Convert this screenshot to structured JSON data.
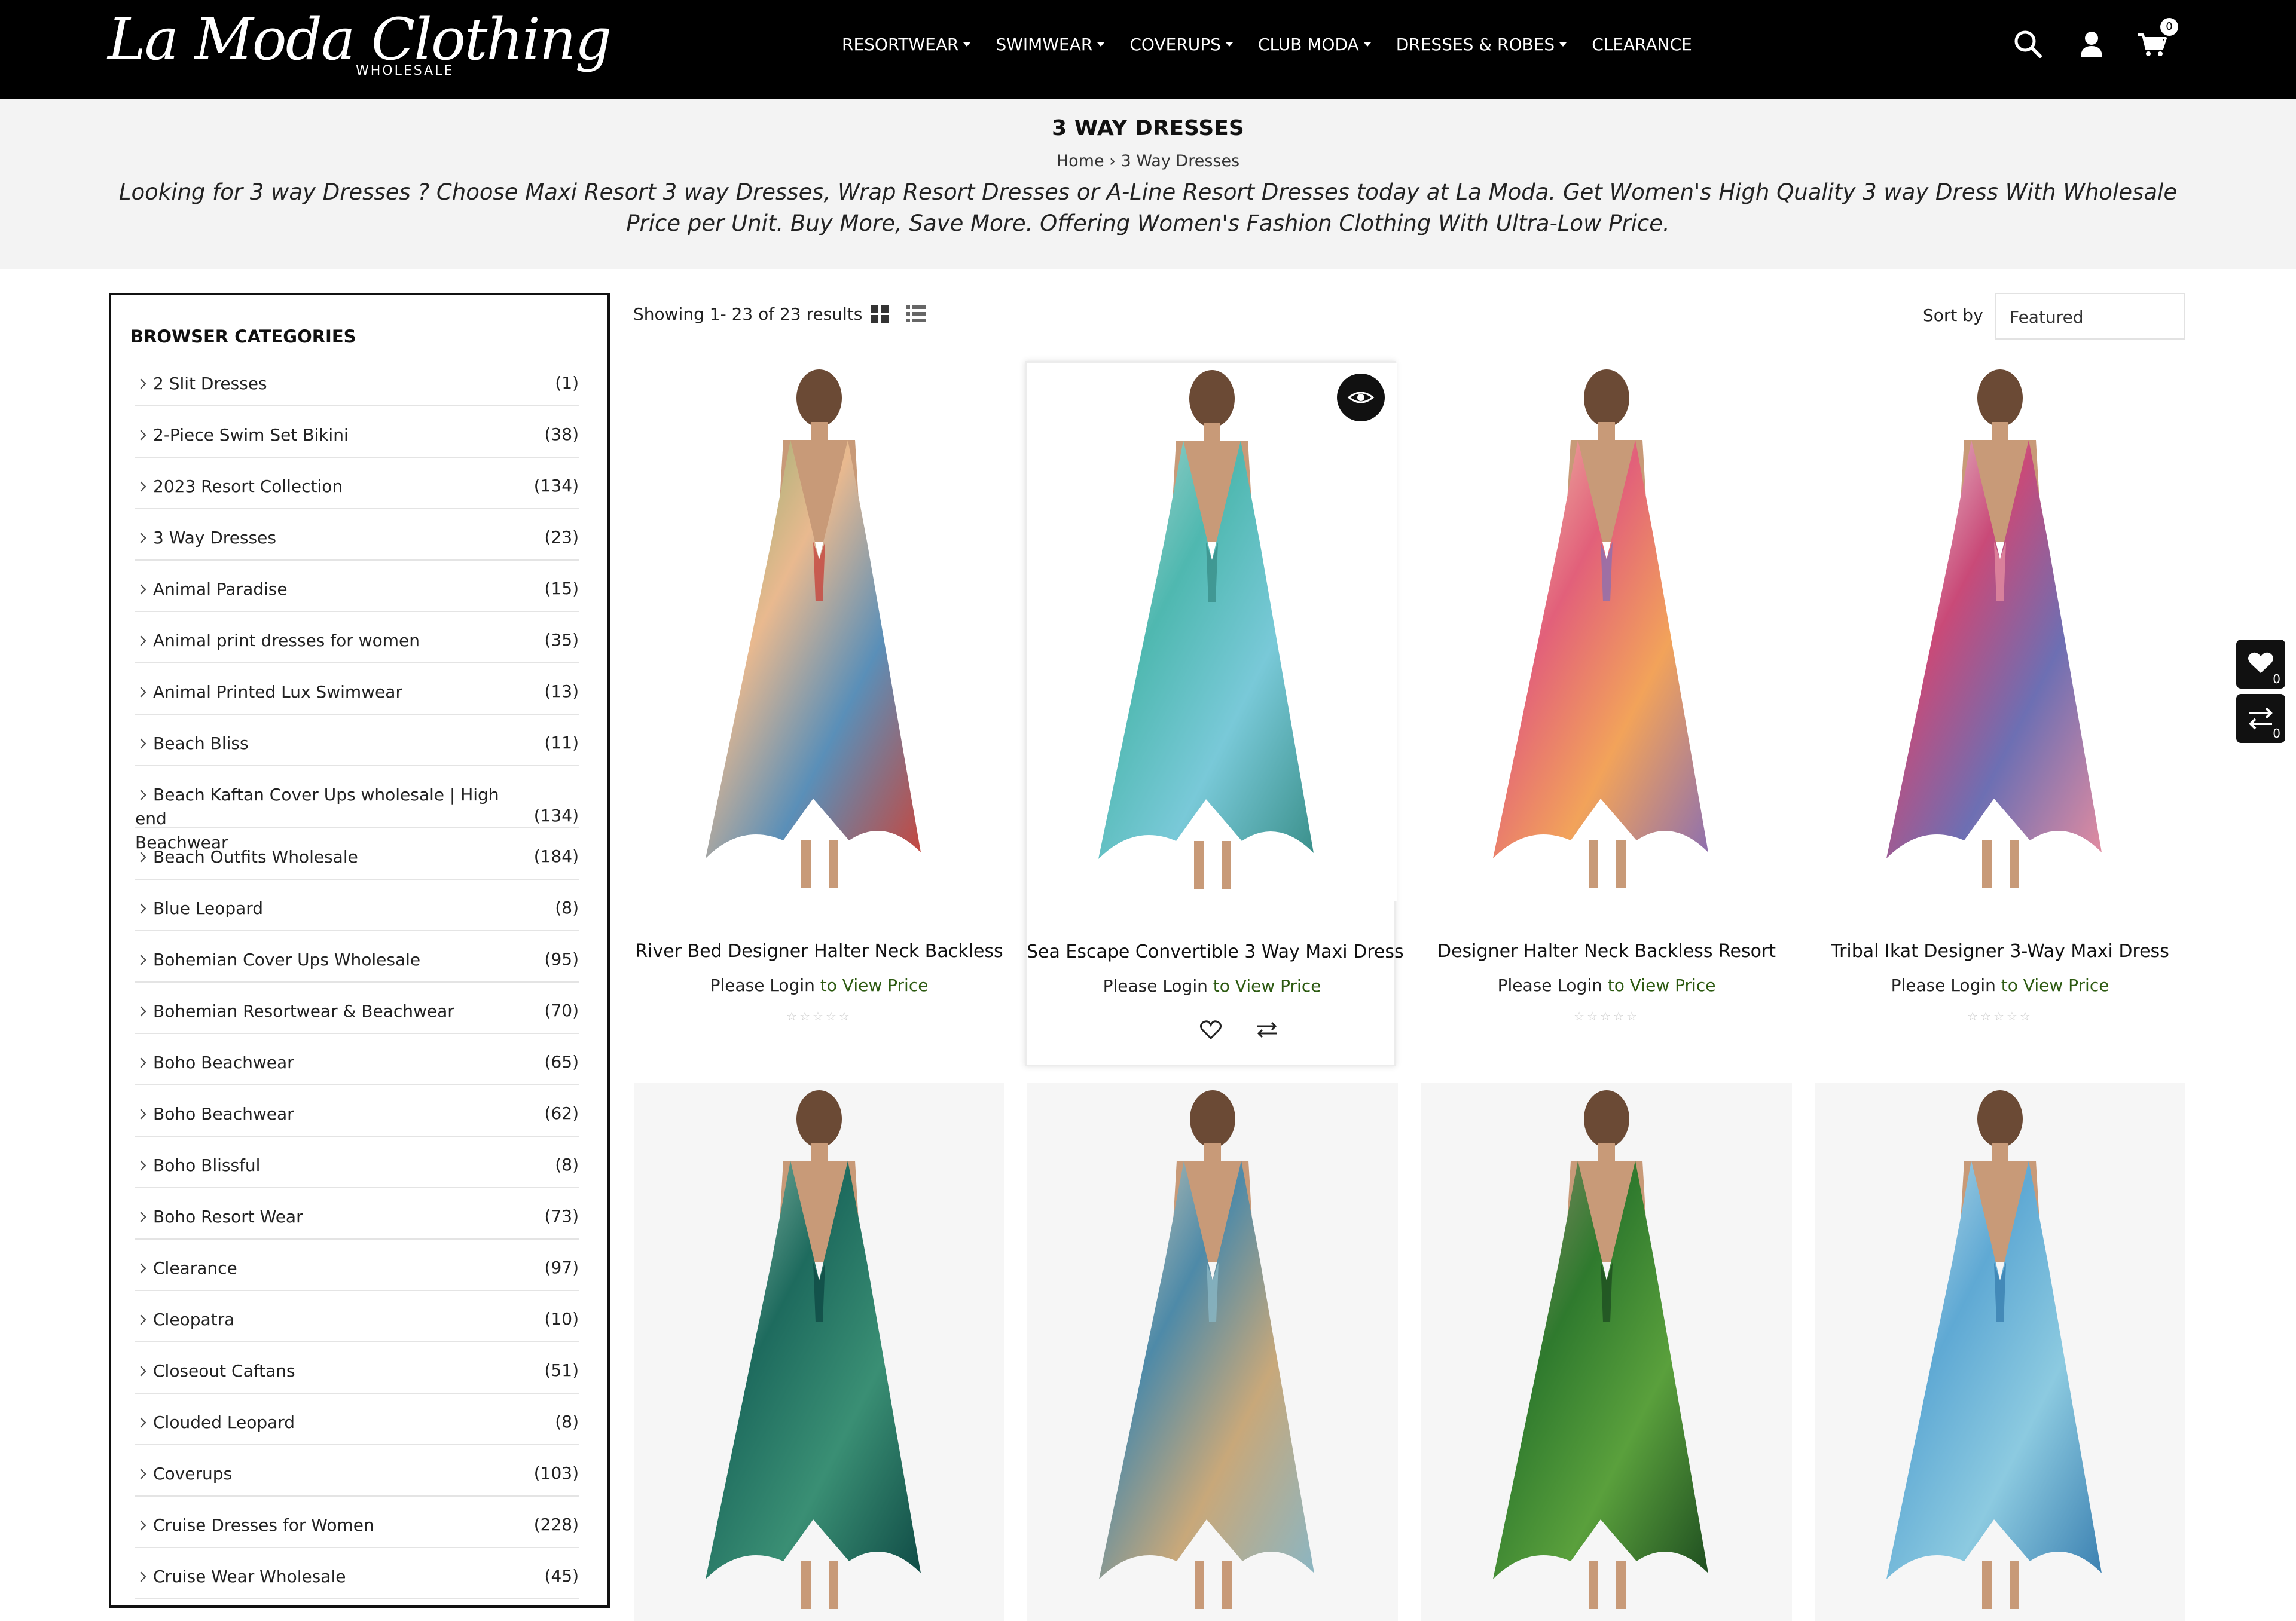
{
  "header": {
    "logo_text": "La Moda Clothing",
    "logo_sub": "WHOLESALE",
    "nav": [
      {
        "label": "RESORTWEAR",
        "dropdown": true
      },
      {
        "label": "SWIMWEAR",
        "dropdown": true
      },
      {
        "label": "COVERUPS",
        "dropdown": true
      },
      {
        "label": "CLUB MODA",
        "dropdown": true
      },
      {
        "label": "DRESSES & ROBES",
        "dropdown": true
      },
      {
        "label": "CLEARANCE",
        "dropdown": false
      }
    ],
    "icons": [
      "search-icon",
      "user-icon",
      "cart-icon"
    ],
    "cart_count": "0"
  },
  "banner": {
    "title": "3 WAY DRESSES",
    "breadcrumb_home": "Home",
    "breadcrumb_sep": "›",
    "breadcrumb_current": "3 Way Dresses",
    "description": "Looking for 3 way Dresses ? Choose Maxi Resort 3 way Dresses, Wrap Resort Dresses or A-Line Resort Dresses today at La Moda. Get Women's High Quality 3 way Dress With Wholesale Price per Unit. Buy More, Save More. Offering Women's Fashion Clothing With Ultra-Low Price."
  },
  "sidebar": {
    "title": "BROWSER CATEGORIES",
    "categories": [
      {
        "label": "2 Slit Dresses",
        "count": "(1)"
      },
      {
        "label": "2-Piece Swim Set Bikini",
        "count": "(38)"
      },
      {
        "label": "2023 Resort Collection",
        "count": "(134)"
      },
      {
        "label": "3 Way Dresses",
        "count": "(23)"
      },
      {
        "label": "Animal Paradise",
        "count": "(15)"
      },
      {
        "label": "Animal print dresses for women",
        "count": "(35)"
      },
      {
        "label": "Animal Printed Lux Swimwear",
        "count": "(13)"
      },
      {
        "label": "Beach Bliss",
        "count": "(11)"
      },
      {
        "label": "Beach Kaftan Cover Ups wholesale | High end",
        "label2": "Beachwear",
        "count": "(134)"
      },
      {
        "label": "Beach Outfits Wholesale",
        "count": "(184)"
      },
      {
        "label": "Blue Leopard",
        "count": "(8)"
      },
      {
        "label": "Bohemian Cover Ups Wholesale",
        "count": "(95)"
      },
      {
        "label": "Bohemian Resortwear & Beachwear",
        "count": "(70)"
      },
      {
        "label": "Boho Beachwear",
        "count": "(65)"
      },
      {
        "label": "Boho Beachwear",
        "count": "(62)"
      },
      {
        "label": "Boho Blissful",
        "count": "(8)"
      },
      {
        "label": "Boho Resort Wear",
        "count": "(73)"
      },
      {
        "label": "Clearance",
        "count": "(97)"
      },
      {
        "label": "Cleopatra",
        "count": "(10)"
      },
      {
        "label": "Closeout Caftans",
        "count": "(51)"
      },
      {
        "label": "Clouded Leopard",
        "count": "(8)"
      },
      {
        "label": "Coverups",
        "count": "(103)"
      },
      {
        "label": "Cruise Dresses for Women",
        "count": "(228)"
      },
      {
        "label": "Cruise Wear Wholesale",
        "count": "(45)"
      }
    ]
  },
  "toolbar": {
    "showing": "Showing 1- 23 of 23 results",
    "sort_label": "Sort by",
    "sort_value": "Featured"
  },
  "products": [
    {
      "name": "River Bed Designer Halter Neck Backless",
      "login": "Please Login",
      "price_text": " to View Price",
      "stars": "☆☆☆☆☆",
      "colors": [
        "#e9b98f",
        "#5a8fb8",
        "#c7463d",
        "#7fae6a"
      ]
    },
    {
      "name": "Sea Escape Convertible 3 Way Maxi Dress",
      "login": "Please Login",
      "price_text": " to View Price",
      "stars": "",
      "colors": [
        "#4fb8b0",
        "#79c9d8",
        "#3a8f8a",
        "#b5d8d0"
      ]
    },
    {
      "name": "Designer Halter Neck Backless Resort",
      "login": "Please Login",
      "price_text": " to View Price",
      "stars": "☆☆☆☆☆",
      "colors": [
        "#e2607a",
        "#f2a35a",
        "#8c6fb0",
        "#f0d0b0"
      ]
    },
    {
      "name": "Tribal Ikat Designer 3-Way Maxi Dress",
      "login": "Please Login",
      "price_text": " to View Price",
      "stars": "☆☆☆☆☆",
      "colors": [
        "#c94a78",
        "#6d6fb3",
        "#e38ca0",
        "#f2e6e6"
      ]
    },
    {
      "name": "",
      "colors": [
        "#1e6b5e",
        "#3a8f74",
        "#0f4a45",
        "#9ec6b4"
      ]
    },
    {
      "name": "",
      "colors": [
        "#4e8aa8",
        "#c8a87a",
        "#8ab6c4",
        "#e0d2b8"
      ]
    },
    {
      "name": "",
      "colors": [
        "#2f7a2e",
        "#5aa03c",
        "#1e4d20",
        "#9c8c74"
      ]
    },
    {
      "name": "",
      "colors": [
        "#5fa9d4",
        "#8ccae0",
        "#3a7fb0",
        "#c8e2ea"
      ]
    }
  ],
  "floating": {
    "wishlist_count": "0",
    "compare_count": "0"
  }
}
